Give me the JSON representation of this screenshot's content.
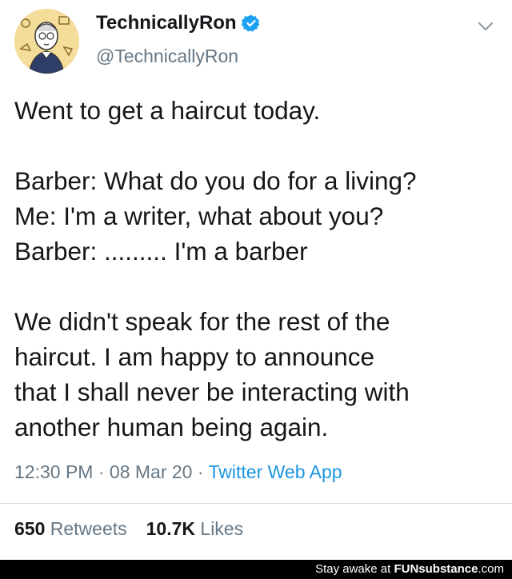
{
  "author": {
    "display_name": "TechnicallyRon",
    "handle": "@TechnicallyRon",
    "verified": true
  },
  "tweet": {
    "lines": [
      "Went to get a haircut today.",
      "",
      "Barber: What do you do for a living?",
      "Me: I'm a writer, what about you?",
      "Barber: ......... I'm a barber",
      "",
      "We didn't speak for the rest of the",
      "haircut. I am happy to announce",
      "that I shall never be interacting with",
      "another human being again."
    ],
    "time": "12:30 PM",
    "separator": "·",
    "date": "08 Mar 20",
    "source": "Twitter Web App"
  },
  "stats": {
    "retweets_count": "650",
    "retweets_label": "Retweets",
    "likes_count": "10.7K",
    "likes_label": "Likes"
  },
  "watermark": {
    "prefix": "Stay awake at ",
    "brand": "FUNsubstance",
    "suffix": ".com"
  },
  "colors": {
    "text": "#14171a",
    "secondary": "#657786",
    "link": "#1b95e0",
    "verified": "#1da1f2"
  }
}
